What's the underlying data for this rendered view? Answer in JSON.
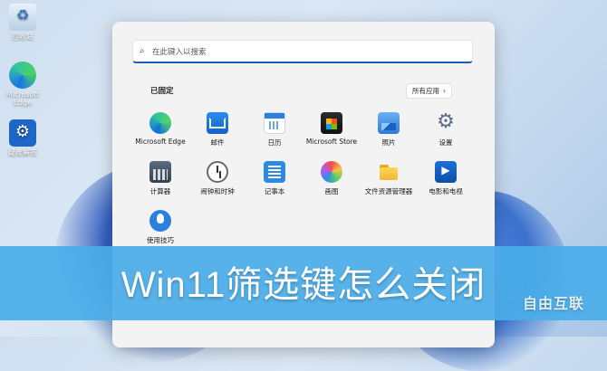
{
  "desktop": {
    "icons": [
      {
        "label": "回收站",
        "icon": "recycle-bin-icon"
      },
      {
        "label": "Microsoft Edge",
        "icon": "edge-icon"
      },
      {
        "label": "疑难解答",
        "icon": "tool-icon"
      }
    ]
  },
  "start_menu": {
    "search": {
      "placeholder": "在此键入以搜索",
      "icon": "search-icon"
    },
    "pinned_title": "已固定",
    "all_apps_label": "所有应用",
    "apps": [
      {
        "label": "Microsoft Edge",
        "icon": "edge-icon"
      },
      {
        "label": "邮件",
        "icon": "mail-icon"
      },
      {
        "label": "日历",
        "icon": "calendar-icon"
      },
      {
        "label": "Microsoft Store",
        "icon": "store-icon"
      },
      {
        "label": "照片",
        "icon": "photos-icon"
      },
      {
        "label": "设置",
        "icon": "settings-icon"
      },
      {
        "label": "计算器",
        "icon": "calculator-icon"
      },
      {
        "label": "闹钟和时钟",
        "icon": "clock-icon"
      },
      {
        "label": "记事本",
        "icon": "notepad-icon"
      },
      {
        "label": "画图",
        "icon": "paint-icon"
      },
      {
        "label": "文件资源管理器",
        "icon": "folder-icon"
      },
      {
        "label": "电影和电视",
        "icon": "film-icon"
      },
      {
        "label": "使用技巧",
        "icon": "tips-icon"
      }
    ]
  },
  "banner": {
    "title": "Win11筛选键怎么关闭",
    "watermark": "自由互联"
  }
}
